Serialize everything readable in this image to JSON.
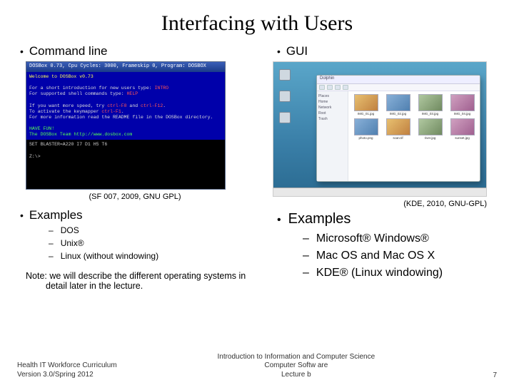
{
  "title": "Interfacing with Users",
  "left": {
    "heading": "Command line",
    "dosbox": {
      "titlebar": "DOSBox 0.73, Cpu Cycles:   3000, Frameskip  0, Program:  DOSBOX",
      "line_welcome": "Welcome to DOSBox v0.73",
      "line_intro1": "For a short introduction for new users type: ",
      "intro_cmd": "INTRO",
      "line_intro2": "For supported shell commands type: ",
      "help_cmd": "HELP",
      "line_speed1": "If you want more speed, try ",
      "speed_key": "ctrl-F8",
      "line_speed2": " and ",
      "speed_key2": "ctrl-F12",
      "line_keymap1": "To activate the keymapper ",
      "keymap_key": "ctrl-F1",
      "line_readme": "For more information read the README file in the DOSBox directory.",
      "line_fun": "HAVE FUN!",
      "line_team": "The DOSBox Team http://www.dosbox.com",
      "black_line1": "SET BLASTER=A220 I7 D1 H5 T6",
      "black_line2": "Z:\\>"
    },
    "caption": "(SF 007, 2009, GNU GPL)",
    "examples_label": "Examples",
    "examples": [
      "DOS",
      "Unix®",
      "Linux (without windowing)"
    ],
    "note": "Note:  we will describe the different operating systems in detail later in the lecture."
  },
  "right": {
    "heading": "GUI",
    "gui": {
      "window_title": "Dolphin",
      "sidebar": [
        "Places",
        "Home",
        "Network",
        "Root",
        "Trash"
      ],
      "thumbs": [
        "IMG_01.jpg",
        "IMG_02.jpg",
        "IMG_03.jpg",
        "IMG_04.jpg",
        "photo.png",
        "scan.tif",
        "river.jpg",
        "sunset.jpg"
      ]
    },
    "caption": "(KDE, 2010, GNU-GPL)",
    "examples_label": "Examples",
    "examples": [
      "Microsoft® Windows®",
      "Mac OS and Mac OS X",
      "KDE® (Linux windowing)"
    ]
  },
  "footer": {
    "left_line1": "Health IT Workforce Curriculum",
    "left_line2": "Version 3.0/Spring 2012",
    "center_line1": "Introduction to Information and Computer Science",
    "center_line2": "Computer Softw are",
    "center_line3": "Lecture b",
    "page": "7"
  }
}
